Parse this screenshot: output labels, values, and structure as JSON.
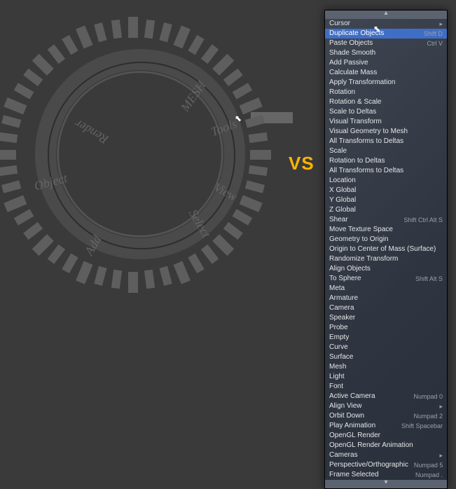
{
  "vs_label": "VS",
  "pie": {
    "sections": [
      {
        "label": "Render",
        "angle_deg": -60
      },
      {
        "label": "MESH",
        "angle_deg": 35
      },
      {
        "label": "Tools",
        "angle_deg": 70
      },
      {
        "label": "View",
        "angle_deg": 118
      },
      {
        "label": "Select",
        "angle_deg": 150
      },
      {
        "label": "Add",
        "angle_deg": 210
      },
      {
        "label": "Object",
        "angle_deg": 255
      }
    ],
    "ring_radius": 130,
    "tick_radius": 167,
    "tick_count": 48
  },
  "menu": {
    "highlighted_index": 1,
    "items": [
      {
        "label": "Cursor",
        "submenu": true
      },
      {
        "label": "Duplicate Objects",
        "shortcut": "Shift D"
      },
      {
        "label": "Paste Objects",
        "shortcut": "Ctrl V"
      },
      {
        "label": "Shade Smooth"
      },
      {
        "label": "Add Passive"
      },
      {
        "label": "Calculate Mass"
      },
      {
        "label": "Apply Transformation"
      },
      {
        "label": "Rotation"
      },
      {
        "label": "Rotation & Scale"
      },
      {
        "label": "Scale to Deltas"
      },
      {
        "label": "Visual Transform"
      },
      {
        "label": "Visual Geometry to Mesh"
      },
      {
        "label": "All Transforms to Deltas"
      },
      {
        "label": "Scale"
      },
      {
        "label": "Rotation to Deltas"
      },
      {
        "label": "All Transforms to Deltas"
      },
      {
        "label": "Location"
      },
      {
        "label": "X Global"
      },
      {
        "label": "Y Global"
      },
      {
        "label": "Z Global"
      },
      {
        "label": "Shear",
        "shortcut": "Shift Ctrl Alt S"
      },
      {
        "label": "Move Texture Space"
      },
      {
        "label": "Geometry to Origin"
      },
      {
        "label": "Origin to Center of Mass (Surface)"
      },
      {
        "label": "Randomize Transform"
      },
      {
        "label": "Align Objects"
      },
      {
        "label": "To Sphere",
        "shortcut": "Shift Alt S"
      },
      {
        "label": "Meta"
      },
      {
        "label": "Armature"
      },
      {
        "label": "Camera"
      },
      {
        "label": "Speaker"
      },
      {
        "label": "Probe"
      },
      {
        "label": "Empty"
      },
      {
        "label": "Curve"
      },
      {
        "label": "Surface"
      },
      {
        "label": "Mesh"
      },
      {
        "label": "Light"
      },
      {
        "label": "Font"
      },
      {
        "label": "Active Camera",
        "shortcut": "Numpad 0"
      },
      {
        "label": "Align View",
        "submenu": true
      },
      {
        "label": "Orbit Down",
        "shortcut": "Numpad 2"
      },
      {
        "label": "Play Animation",
        "shortcut": "Shift Spacebar"
      },
      {
        "label": "OpenGL Render"
      },
      {
        "label": "OpenGL Render Animation"
      },
      {
        "label": "Cameras",
        "submenu": true
      },
      {
        "label": "Perspective/Orthographic",
        "shortcut": "Numpad 5"
      },
      {
        "label": "Frame Selected",
        "shortcut": "Numpad ."
      }
    ]
  }
}
